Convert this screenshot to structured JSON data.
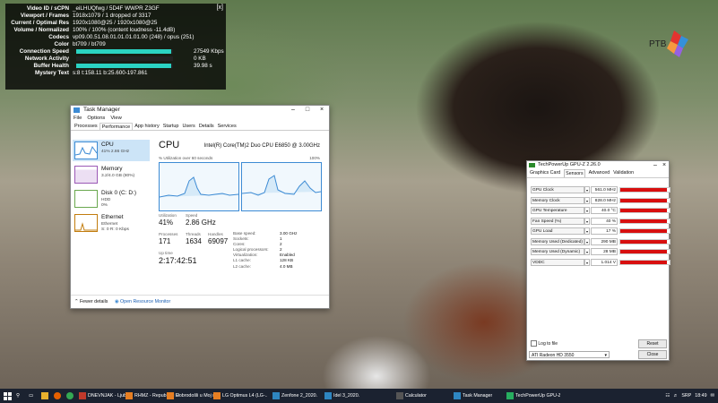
{
  "overlay": {
    "close": "[x]",
    "rows": [
      {
        "k": "Video ID / sCPN",
        "v": "_eiLHUQfwg / 5D4F WWPR Z3GF"
      },
      {
        "k": "Viewport / Frames",
        "v": "1918x1079 / 1 dropped of 3317"
      },
      {
        "k": "Current / Optimal Res",
        "v": "1920x1080@25 / 1920x1080@25"
      },
      {
        "k": "Volume / Normalized",
        "v": "100% / 100% (content loudness -11.4dB)"
      },
      {
        "k": "Codecs",
        "v": "vp09.00.51.08.01.01.01.01.00 (248) / opus (251)"
      },
      {
        "k": "Color",
        "v": "bt709 / bt709"
      },
      {
        "k": "Connection Speed",
        "v": ""
      },
      {
        "k": "Network Activity",
        "v": ""
      },
      {
        "k": "Buffer Health",
        "v": ""
      },
      {
        "k": "Mystery Text",
        "v": "s:8 t:158.11 b:25.600-197.861"
      }
    ],
    "connection_value": "27549 Kbps",
    "network_value": "0 KB",
    "buffer_value": "39.98 s",
    "connection_fill": 0.98,
    "network_fill": 0.0,
    "buffer_fill": 0.98,
    "bar_color": "#2bd3c3"
  },
  "logo": {
    "text": "PTB"
  },
  "task_manager": {
    "title": "Task Manager",
    "menu": [
      "File",
      "Options",
      "View"
    ],
    "tabs": [
      "Processes",
      "Performance",
      "App history",
      "Startup",
      "Users",
      "Details",
      "Services"
    ],
    "active_tab": "Performance",
    "sidebar": [
      {
        "name": "CPU",
        "sub": "41% 2.86 GHz"
      },
      {
        "name": "Memory",
        "sub": "3.2/4.0 GB (80%)"
      },
      {
        "name": "Disk 0 (C: D:)",
        "sub": "HDD\n0%"
      },
      {
        "name": "Ethernet",
        "sub": "Ethernet\nS: 0 R: 0 Kbps"
      }
    ],
    "cpu_heading": "CPU",
    "cpu_model": "Intel(R) Core(TM)2 Duo CPU E6850 @ 3.00GHz",
    "graph_label": "% Utilization over 60 seconds",
    "graph_max": "100%",
    "stats": {
      "utilization_label": "Utilization",
      "utilization": "41%",
      "speed_label": "Speed",
      "speed": "2.86 GHz",
      "processes_label": "Processes",
      "processes": "171",
      "threads_label": "Threads",
      "threads": "1634",
      "handles_label": "Handles",
      "handles": "69097",
      "uptime_label": "Up time",
      "uptime": "2:17:42:51"
    },
    "details": [
      {
        "k": "Base speed:",
        "v": "3.00 GHz"
      },
      {
        "k": "Sockets:",
        "v": "1"
      },
      {
        "k": "Cores:",
        "v": "2"
      },
      {
        "k": "Logical processors:",
        "v": "2"
      },
      {
        "k": "Virtualization:",
        "v": "Enabled"
      },
      {
        "k": "L1 cache:",
        "v": "128 KB"
      },
      {
        "k": "L2 cache:",
        "v": "4.0 MB"
      }
    ],
    "fewer_details": "Fewer details",
    "open_monitor": "Open Resource Monitor"
  },
  "gpuz": {
    "title": "TechPowerUp GPU-Z 2.26.0",
    "tabs": [
      "Graphics Card",
      "Sensors",
      "Advanced",
      "Validation"
    ],
    "active_tab": "Sensors",
    "sensors": [
      {
        "label": "GPU Clock",
        "value": "561.0 MHz",
        "level": 0.95
      },
      {
        "label": "Memory Clock",
        "value": "828.0 MHz",
        "level": 0.95
      },
      {
        "label": "GPU Temperature",
        "value": "40.0 °C",
        "level": 0.95
      },
      {
        "label": "Fan Speed (%)",
        "value": "40 %",
        "level": 0.95
      },
      {
        "label": "GPU Load",
        "value": "17 %",
        "level": 0.95
      },
      {
        "label": "Memory Used (Dedicated)",
        "value": "290 MB",
        "level": 0.95
      },
      {
        "label": "Memory Used (Dynamic)",
        "value": "28 MB",
        "level": 0.95
      },
      {
        "label": "VDDC",
        "value": "1.014 V",
        "level": 0.95
      }
    ],
    "log_label": "Log to file",
    "reset": "Reset",
    "gpu_select": "ATI Radeon HD 3550",
    "close": "Close"
  },
  "taskbar": {
    "items": [
      {
        "label": "DNEVNJAK - Ljubom...",
        "color": "#c0392b"
      },
      {
        "label": "RHMZ - Republicki H...",
        "color": "#e67e22"
      },
      {
        "label": "Dobrodošli u Moj mt...",
        "color": "#e67e22"
      },
      {
        "label": "LG Optimus L4 (LG-...",
        "color": "#e67e22"
      },
      {
        "label": "Zenfone 2_2020.",
        "color": "#2e86c1"
      },
      {
        "label": "Idel 3_2020.",
        "color": "#2e86c1"
      },
      {
        "label": "Calculator",
        "color": "#555"
      },
      {
        "label": "Task Manager",
        "color": "#2e86c1"
      },
      {
        "label": "TechPowerUp GPU-Z...",
        "color": "#27ae60"
      }
    ],
    "lang": "SRP",
    "time": "18:49"
  }
}
